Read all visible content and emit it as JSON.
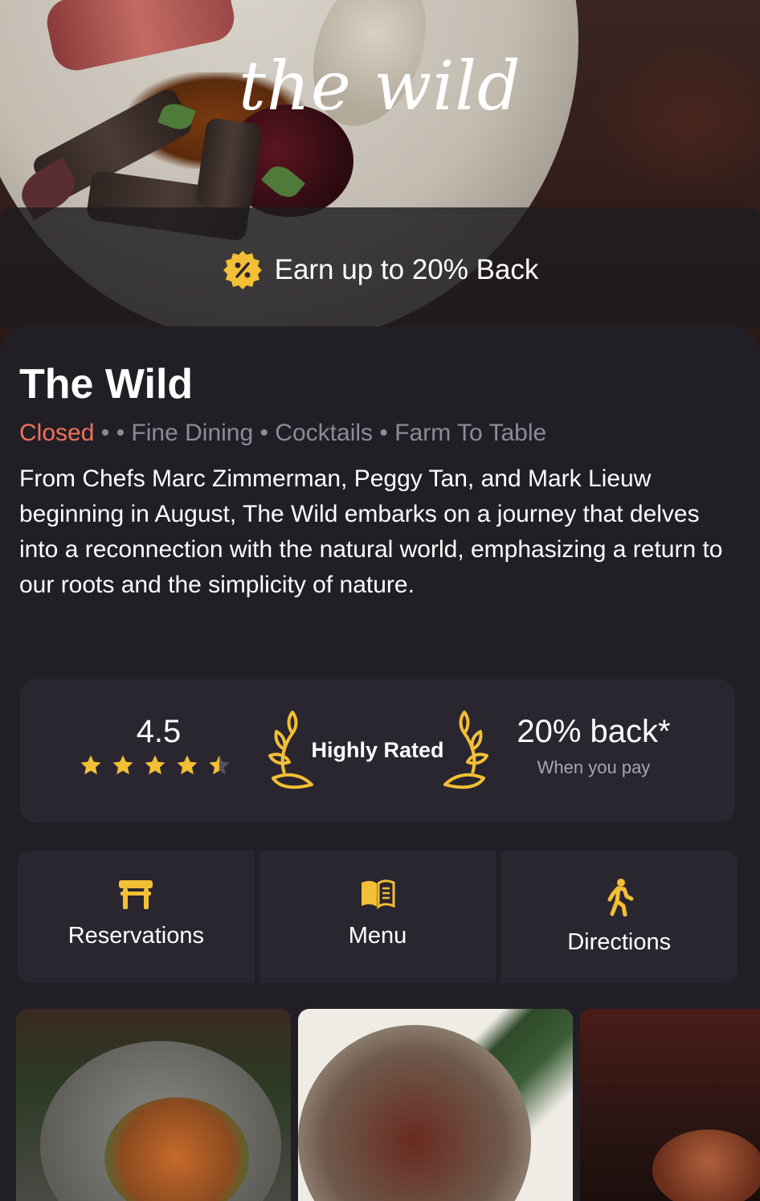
{
  "hero": {
    "logo_text": "the wild",
    "promo_text": "Earn up to 20% Back",
    "promo_icon": "percent-badge-icon"
  },
  "restaurant": {
    "name": "The Wild",
    "status": "Closed",
    "separator": " • ",
    "categories": "• Fine Dining • Cocktails • Farm To Table",
    "description": "From Chefs Marc Zimmerman, Peggy Tan, and Mark Lieuw beginning in August, The Wild embarks on a journey that delves into a reconnection with the natural world, emphasizing a return to our roots and the simplicity of nature."
  },
  "stats": {
    "rating": "4.5",
    "stars": 4.5,
    "badge_label": "Highly Rated",
    "cashback_title": "20% back*",
    "cashback_sub": "When you pay"
  },
  "actions": [
    {
      "label": "Reservations",
      "icon": "table-icon"
    },
    {
      "label": "Menu",
      "icon": "menu-book-icon"
    },
    {
      "label": "Directions",
      "icon": "walking-icon"
    }
  ],
  "colors": {
    "background": "#221e26",
    "card": "#2a2630",
    "accent": "#f2bf35",
    "closed": "#f0735a",
    "muted": "#8f8a96"
  }
}
